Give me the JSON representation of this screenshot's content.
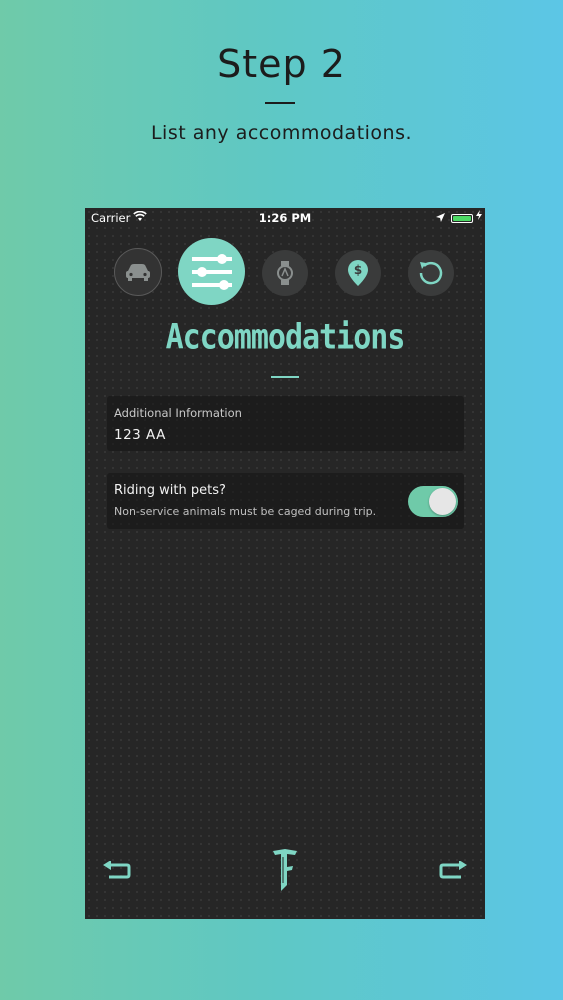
{
  "promo": {
    "title": "Step 2",
    "subtitle": "List any accommodations."
  },
  "status_bar": {
    "carrier": "Carrier",
    "time": "1:26 PM"
  },
  "steps": [
    {
      "icon": "car-icon",
      "state": "completed"
    },
    {
      "icon": "sliders-icon",
      "state": "active"
    },
    {
      "icon": "watch-icon",
      "state": "upcoming"
    },
    {
      "icon": "money-pin-icon",
      "state": "upcoming"
    },
    {
      "icon": "reset-icon",
      "state": "upcoming"
    }
  ],
  "screen": {
    "title": "Accommodations",
    "additional_info": {
      "label": "Additional Information",
      "value": "123 AA"
    },
    "pets": {
      "title": "Riding with pets?",
      "subtitle": "Non-service animals must be caged during trip.",
      "enabled": true
    }
  },
  "colors": {
    "accent": "#7fd6c4",
    "toggle_on": "#6fcaa9",
    "background": "#262626",
    "battery": "#4cd964"
  }
}
